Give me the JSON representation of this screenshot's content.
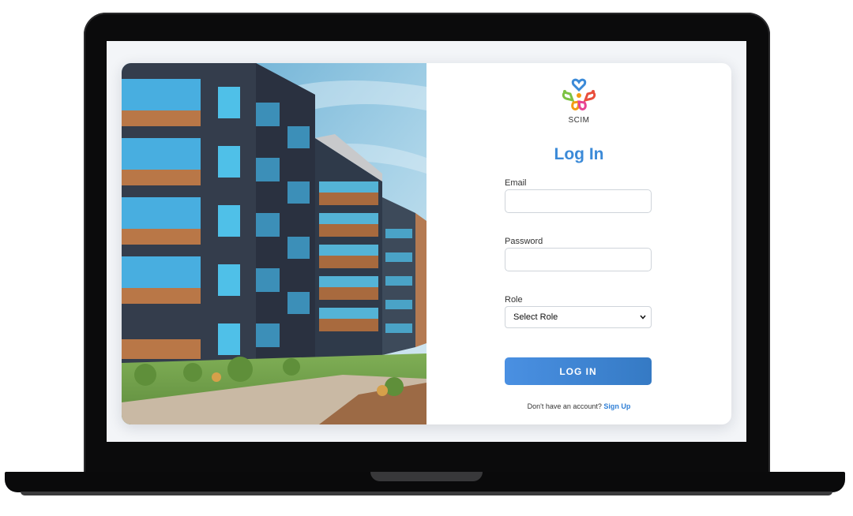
{
  "brand": {
    "name": "SCIM",
    "logo_icon": "heart-cluster-logo-icon",
    "logo_colors": [
      "#3b8ad8",
      "#e94e3c",
      "#f39c12",
      "#7cc243",
      "#e84393"
    ]
  },
  "page": {
    "title": "Log In",
    "photo": "apartment-building-photo"
  },
  "form": {
    "email": {
      "label": "Email",
      "value": "",
      "placeholder": ""
    },
    "password": {
      "label": "Password",
      "value": "",
      "placeholder": ""
    },
    "role": {
      "label": "Role",
      "selected": "Select Role"
    },
    "submit_label": "LOG IN",
    "signup_prompt": "Don't have an account?",
    "signup_link": "Sign Up"
  },
  "colors": {
    "accent": "#3b8ad8",
    "button": "#4a90e2",
    "link": "#2f7fd6"
  }
}
